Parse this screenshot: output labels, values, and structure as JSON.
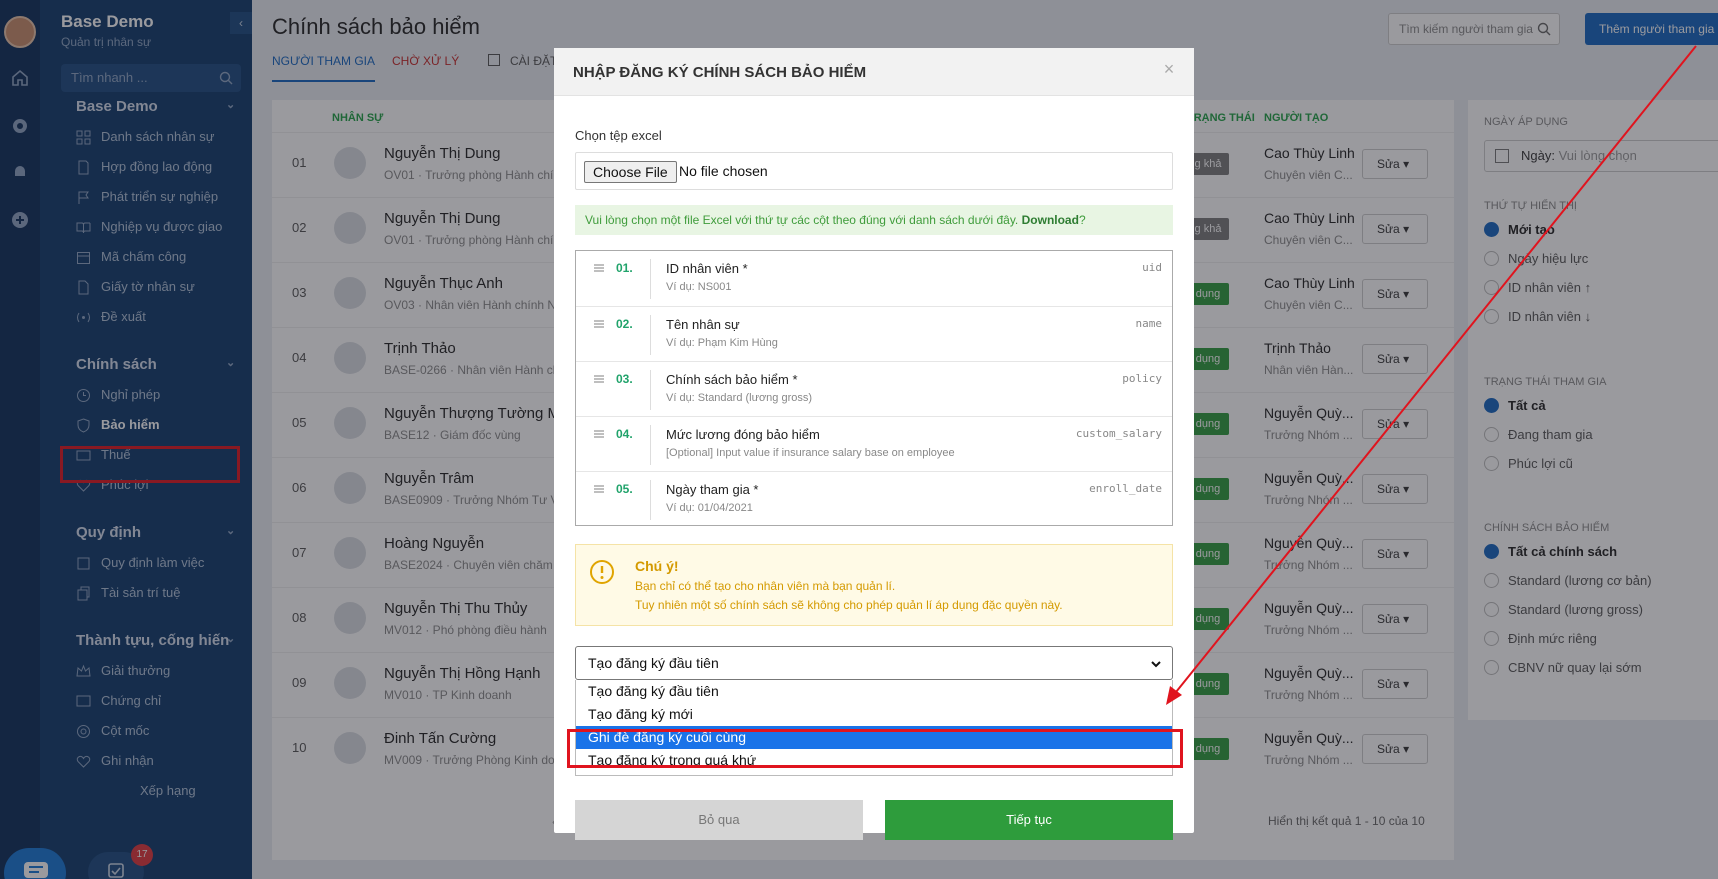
{
  "sidebar": {
    "brand": "Base Demo",
    "brand_sub": "Quản trị nhân sự",
    "quick_placeholder": "Tìm nhanh ...",
    "collapse": "‹",
    "groups": [
      {
        "title": "Base Demo",
        "items": [
          "Danh sách nhân sự",
          "Hợp đồng lao động",
          "Phát triển sự nghiệp",
          "Nghiệp vụ được giao",
          "Mã chấm công",
          "Giấy tờ nhân sự",
          "Đề xuất"
        ]
      },
      {
        "title": "Chính sách",
        "items": [
          "Nghỉ phép",
          "Bảo hiểm",
          "Thuế",
          "Phúc lợi"
        ]
      },
      {
        "title": "Quy định",
        "items": [
          "Quy định làm việc",
          "Tài sản trí tuệ"
        ]
      },
      {
        "title": "Thành tựu, cống hiến",
        "items": [
          "Giải thưởng",
          "Chứng chỉ",
          "Cột mốc",
          "Ghi nhận",
          "Xếp hạng"
        ]
      }
    ],
    "badge_count": "17"
  },
  "header": {
    "title": "Chính sách bảo hiểm",
    "tabs": [
      "NGƯỜI THAM GIA",
      "CHỜ XỬ LÝ",
      "CÀI ĐẶT"
    ],
    "search_placeholder": "Tìm kiếm người tham gia",
    "add_button": "Thêm người tham gia"
  },
  "table": {
    "headers": {
      "staff": "NHÂN SỰ",
      "status": "TRẠNG THÁI",
      "creator": "NGƯỜI TẠO"
    },
    "status_labels": {
      "pending": "g khả dụng",
      "active": "dụng"
    },
    "edit_label": "Sửa",
    "rows": [
      {
        "no": "01",
        "name": "Nguyễn Thị Dung",
        "sub": "OV01 · Trưởng phòng Hành chính",
        "status": "pending",
        "creator": "Cao Thùy Linh",
        "creator_sub": "Chuyên viên C..."
      },
      {
        "no": "02",
        "name": "Nguyễn Thị Dung",
        "sub": "OV01 · Trưởng phòng Hành chính",
        "status": "pending",
        "creator": "Cao Thùy Linh",
        "creator_sub": "Chuyên viên C..."
      },
      {
        "no": "03",
        "name": "Nguyễn Thục Anh",
        "sub": "OV03 · Nhân viên Hành chính Nh",
        "status": "active",
        "creator": "Cao Thùy Linh",
        "creator_sub": "Chuyên viên C..."
      },
      {
        "no": "04",
        "name": "Trịnh Thảo",
        "sub": "BASE-0266 · Nhân viên Hành chí",
        "status": "active",
        "creator": "Trịnh Thảo",
        "creator_sub": "Nhân viên Hàn..."
      },
      {
        "no": "05",
        "name": "Nguyễn Thượng Tường M",
        "sub": "BASE12 · Giám đốc vùng",
        "status": "active",
        "creator": "Nguyễn Quỳ...",
        "creator_sub": "Trưởng Nhóm ..."
      },
      {
        "no": "06",
        "name": "Nguyễn Trâm",
        "sub": "BASE0909 · Trưởng Nhóm Tư Vấ",
        "status": "active",
        "creator": "Nguyễn Quỳ...",
        "creator_sub": "Trưởng Nhóm ..."
      },
      {
        "no": "07",
        "name": "Hoàng Nguyễn",
        "sub": "BASE2024 · Chuyên viên chăm sở",
        "status": "active",
        "creator": "Nguyễn Quỳ...",
        "creator_sub": "Trưởng Nhóm ..."
      },
      {
        "no": "08",
        "name": "Nguyễn Thị Thu Thủy",
        "sub": "MV012 · Phó phòng điều hành",
        "status": "active",
        "creator": "Nguyễn Quỳ...",
        "creator_sub": "Trưởng Nhóm ..."
      },
      {
        "no": "09",
        "name": "Nguyễn Thị Hồng Hạnh",
        "sub": "MV010 · TP Kinh doanh",
        "status": "active",
        "creator": "Nguyễn Quỳ...",
        "creator_sub": "Trưởng Nhóm ..."
      },
      {
        "no": "10",
        "name": "Đinh Tấn Cường",
        "sub": "MV009 · Trưởng Phòng Kinh doa",
        "status": "active",
        "creator": "Nguyễn Quỳ...",
        "creator_sub": "Trưởng Nhóm ..."
      }
    ],
    "page": "1",
    "summary": "Hiển thị kết quả 1 - 10 của 10"
  },
  "filters": {
    "date_header": "NGÀY ÁP DỤNG",
    "date_label": "Ngày:",
    "date_placeholder": "Vui lòng chọn",
    "order_header": "THỨ TỰ HIỂN THỊ",
    "order_options": [
      "Mới tạo",
      "Ngày hiệu lực",
      "ID nhân viên ↑",
      "ID nhân viên ↓"
    ],
    "status_header": "TRẠNG THÁI THAM GIA",
    "status_options": [
      "Tất cả",
      "Đang tham gia",
      "Phúc lợi cũ"
    ],
    "policy_header": "CHÍNH SÁCH BẢO HIỂM",
    "policy_options": [
      "Tất cả chính sách",
      "Standard (lương cơ bản)",
      "Standard (lương gross)",
      "Định mức riêng",
      "CBNV nữ quay lại sớm"
    ]
  },
  "modal": {
    "title": "NHẬP ĐĂNG KÝ CHÍNH SÁCH BẢO HIỂM",
    "close": "×",
    "file_label": "Chọn tệp excel",
    "file_button": "Choose File",
    "file_status": "No file chosen",
    "info_text": "Vui lòng chọn một file Excel với thứ tự các cột theo đúng với danh sách dưới đây.",
    "info_link": "Download",
    "info_q": "?",
    "columns": [
      {
        "idx": "01.",
        "name": "ID nhân viên *",
        "example": "Ví dụ: NS001",
        "key": "uid"
      },
      {
        "idx": "02.",
        "name": "Tên nhân sự",
        "example": "Ví dụ: Phạm Kim Hùng",
        "key": "name"
      },
      {
        "idx": "03.",
        "name": "Chính sách bảo hiểm *",
        "example": "Ví dụ: Standard (lương gross)",
        "key": "policy"
      },
      {
        "idx": "04.",
        "name": "Mức lương đóng bảo hiểm",
        "example": "[Optional] Input value if insurance salary base on employee",
        "key": "custom_salary"
      },
      {
        "idx": "05.",
        "name": "Ngày tham gia *",
        "example": "Ví dụ: 01/04/2021",
        "key": "enroll_date"
      }
    ],
    "warn_title": "Chú ý!",
    "warn_line1": "Bạn chỉ có thể tạo cho nhân viên mà bạn quản lí.",
    "warn_line2": "Tuy nhiên một số chính sách sẽ không cho phép quản lí áp dụng đặc quyền này.",
    "select_value": "Tạo đăng ký đầu tiên",
    "options": [
      "Tạo đăng ký đầu tiên",
      "Tạo đăng ký mới",
      "Ghi đè đăng ký cuối cùng",
      "Tạo đăng ký trong quá khứ"
    ],
    "selected_index": 2,
    "cancel": "Bỏ qua",
    "continue": "Tiếp tục"
  },
  "colors": {
    "accent": "#1565c0",
    "sidebar": "#0f3a6b",
    "success": "#2e9c3c",
    "highlight": "#e0141e"
  }
}
